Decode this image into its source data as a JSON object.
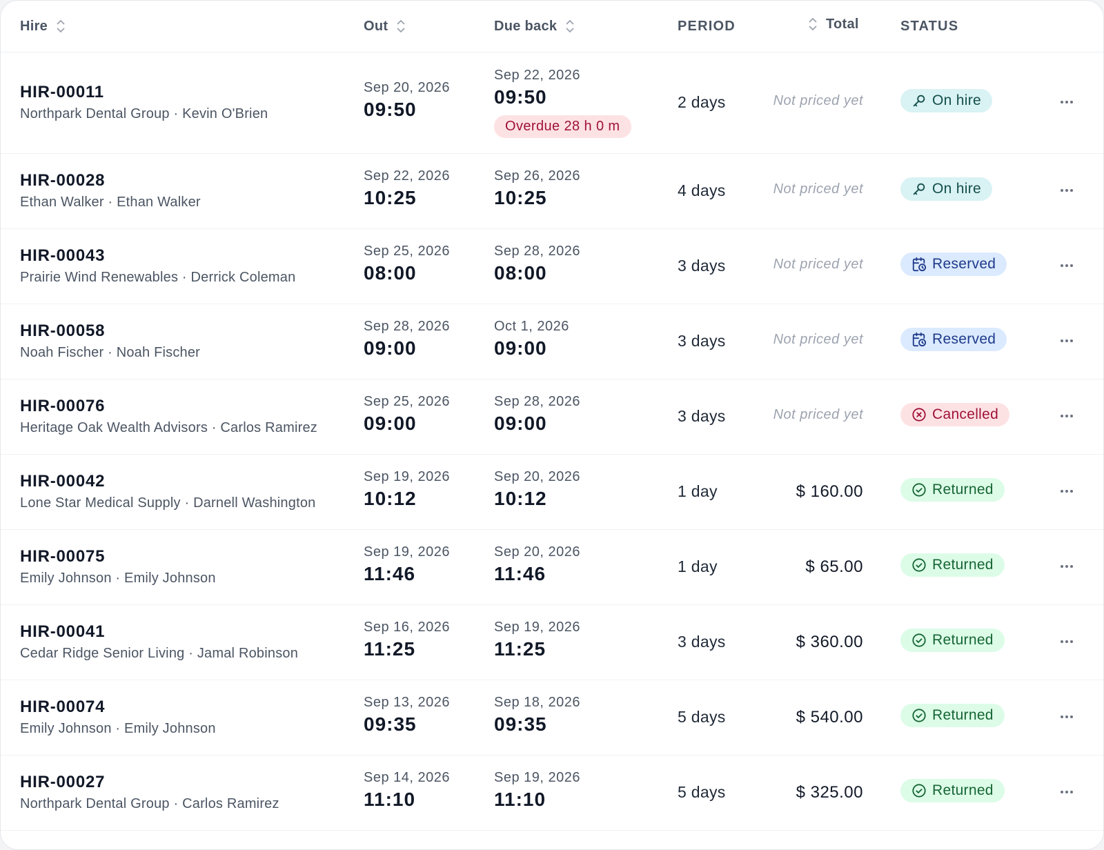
{
  "table": {
    "columns": {
      "hire": "Hire",
      "out": "Out",
      "due_back": "Due back",
      "period": "PERIOD",
      "total": "Total",
      "status": "STATUS"
    },
    "rows": [
      {
        "id": "HIR-00011",
        "sub": "Northpark Dental Group · Kevin O'Brien",
        "out_date": "Sep 20, 2026",
        "out_time": "09:50",
        "due_date": "Sep 22, 2026",
        "due_time": "09:50",
        "overdue": "Overdue 28 h 0 m",
        "period": "2 days",
        "total": "Not priced yet",
        "status": "On hire"
      },
      {
        "id": "HIR-00028",
        "sub": "Ethan Walker · Ethan Walker",
        "out_date": "Sep 22, 2026",
        "out_time": "10:25",
        "due_date": "Sep 26, 2026",
        "due_time": "10:25",
        "period": "4 days",
        "total": "Not priced yet",
        "status": "On hire"
      },
      {
        "id": "HIR-00043",
        "sub": "Prairie Wind Renewables · Derrick Coleman",
        "out_date": "Sep 25, 2026",
        "out_time": "08:00",
        "due_date": "Sep 28, 2026",
        "due_time": "08:00",
        "period": "3 days",
        "total": "Not priced yet",
        "status": "Reserved"
      },
      {
        "id": "HIR-00058",
        "sub": "Noah Fischer · Noah Fischer",
        "out_date": "Sep 28, 2026",
        "out_time": "09:00",
        "due_date": "Oct 1, 2026",
        "due_time": "09:00",
        "period": "3 days",
        "total": "Not priced yet",
        "status": "Reserved"
      },
      {
        "id": "HIR-00076",
        "sub": "Heritage Oak Wealth Advisors · Carlos Ramirez",
        "out_date": "Sep 25, 2026",
        "out_time": "09:00",
        "due_date": "Sep 28, 2026",
        "due_time": "09:00",
        "period": "3 days",
        "total": "Not priced yet",
        "status": "Cancelled"
      },
      {
        "id": "HIR-00042",
        "sub": "Lone Star Medical Supply · Darnell Washington",
        "out_date": "Sep 19, 2026",
        "out_time": "10:12",
        "due_date": "Sep 20, 2026",
        "due_time": "10:12",
        "period": "1 day",
        "total": "$ 160.00",
        "status": "Returned"
      },
      {
        "id": "HIR-00075",
        "sub": "Emily Johnson · Emily Johnson",
        "out_date": "Sep 19, 2026",
        "out_time": "11:46",
        "due_date": "Sep 20, 2026",
        "due_time": "11:46",
        "period": "1 day",
        "total": "$ 65.00",
        "status": "Returned"
      },
      {
        "id": "HIR-00041",
        "sub": "Cedar Ridge Senior Living · Jamal Robinson",
        "out_date": "Sep 16, 2026",
        "out_time": "11:25",
        "due_date": "Sep 19, 2026",
        "due_time": "11:25",
        "period": "3 days",
        "total": "$ 360.00",
        "status": "Returned"
      },
      {
        "id": "HIR-00074",
        "sub": "Emily Johnson · Emily Johnson",
        "out_date": "Sep 13, 2026",
        "out_time": "09:35",
        "due_date": "Sep 18, 2026",
        "due_time": "09:35",
        "period": "5 days",
        "total": "$ 540.00",
        "status": "Returned"
      },
      {
        "id": "HIR-00027",
        "sub": "Northpark Dental Group · Carlos Ramirez",
        "out_date": "Sep 14, 2026",
        "out_time": "11:10",
        "due_date": "Sep 19, 2026",
        "due_time": "11:10",
        "period": "5 days",
        "total": "$ 325.00",
        "status": "Returned"
      }
    ]
  },
  "status_icons": {
    "On hire": "wrench-icon",
    "Reserved": "calendar-clock-icon",
    "Cancelled": "x-circle-icon",
    "Returned": "check-circle-icon"
  },
  "colors": {
    "on_hire_bg": "#d9f2f4",
    "reserved_bg": "#dbeafe",
    "cancelled_bg": "#fde2e4",
    "returned_bg": "#dcfce7",
    "overdue_bg": "#fde2e4"
  }
}
